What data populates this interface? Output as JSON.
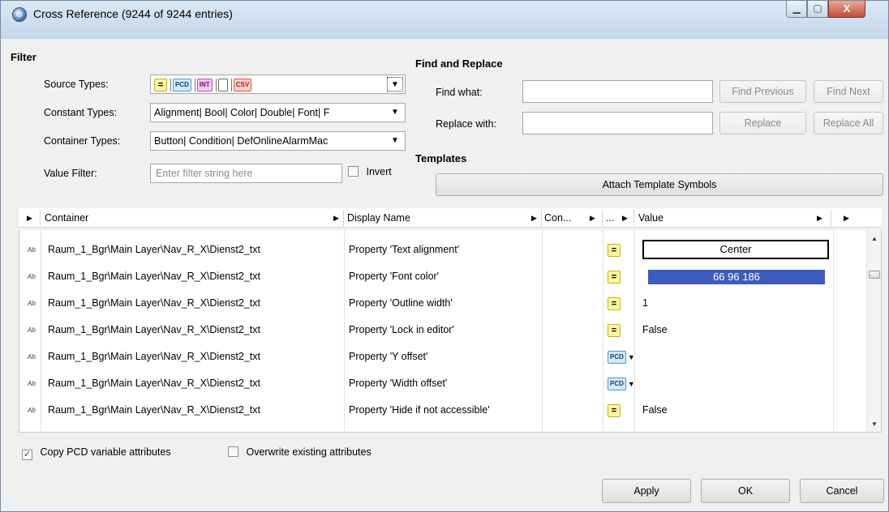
{
  "window": {
    "title": "Cross Reference (9244 of 9244 entries)",
    "close_label": "X"
  },
  "filter": {
    "heading": "Filter",
    "source_types_label": "Source Types:",
    "source_type_chips": [
      "=",
      "PCD",
      "INT",
      "",
      "CSV"
    ],
    "constant_types_label": "Constant Types:",
    "constant_types_value": "Alignment| Bool| Color| Double| Font| F",
    "container_types_label": "Container Types:",
    "container_types_value": "Button| Condition| DefOnlineAlarmMac",
    "value_filter_label": "Value Filter:",
    "value_filter_placeholder": "Enter filter string here",
    "value_filter_value": "",
    "invert_label": "Invert",
    "invert_checked": false
  },
  "find_replace": {
    "heading": "Find and Replace",
    "find_what_label": "Find what:",
    "find_what_value": "",
    "replace_with_label": "Replace with:",
    "replace_with_value": "",
    "find_previous_label": "Find Previous",
    "find_next_label": "Find Next",
    "replace_label": "Replace",
    "replace_all_label": "Replace All"
  },
  "templates": {
    "heading": "Templates",
    "attach_label": "Attach Template Symbols"
  },
  "grid": {
    "columns": [
      "Container",
      "Display Name",
      "Con...",
      "...",
      "Value"
    ],
    "rows": [
      {
        "icon": "Ab",
        "container": "Raum_1_Bgr\\Main Layer\\Nav_R_X\\Dienst2_txt",
        "display_name": "Property 'Text alignment'",
        "con": "",
        "type": "=",
        "value": "Center"
      },
      {
        "icon": "Ab",
        "container": "Raum_1_Bgr\\Main Layer\\Nav_R_X\\Dienst2_txt",
        "display_name": "Property 'Font color'",
        "con": "",
        "type": "=",
        "value": "66 96 186"
      },
      {
        "icon": "Ab",
        "container": "Raum_1_Bgr\\Main Layer\\Nav_R_X\\Dienst2_txt",
        "display_name": "Property 'Outline width'",
        "con": "",
        "type": "=",
        "value": "1"
      },
      {
        "icon": "Ab",
        "container": "Raum_1_Bgr\\Main Layer\\Nav_R_X\\Dienst2_txt",
        "display_name": "Property 'Lock in editor'",
        "con": "",
        "type": "=",
        "value": "False"
      },
      {
        "icon": "Ab",
        "container": "Raum_1_Bgr\\Main Layer\\Nav_R_X\\Dienst2_txt",
        "display_name": "Property 'Y offset'",
        "con": "",
        "type": "PCD",
        "value": ""
      },
      {
        "icon": "Ab",
        "container": "Raum_1_Bgr\\Main Layer\\Nav_R_X\\Dienst2_txt",
        "display_name": "Property 'Width offset'",
        "con": "",
        "type": "PCD",
        "value": ""
      },
      {
        "icon": "Ab",
        "container": "Raum_1_Bgr\\Main Layer\\Nav_R_X\\Dienst2_txt",
        "display_name": "Property 'Hide if not accessible'",
        "con": "",
        "type": "=",
        "value": "False"
      }
    ]
  },
  "options": {
    "copy_pcd_label": "Copy PCD variable attributes",
    "copy_pcd_checked": true,
    "overwrite_label": "Overwrite existing attributes",
    "overwrite_checked": false
  },
  "footer": {
    "apply_label": "Apply",
    "ok_label": "OK",
    "cancel_label": "Cancel"
  },
  "colors": {
    "selection": "#3c5cbf",
    "constant_chip": "#fdf6a2",
    "pcd_chip": "#cfe8ff"
  }
}
